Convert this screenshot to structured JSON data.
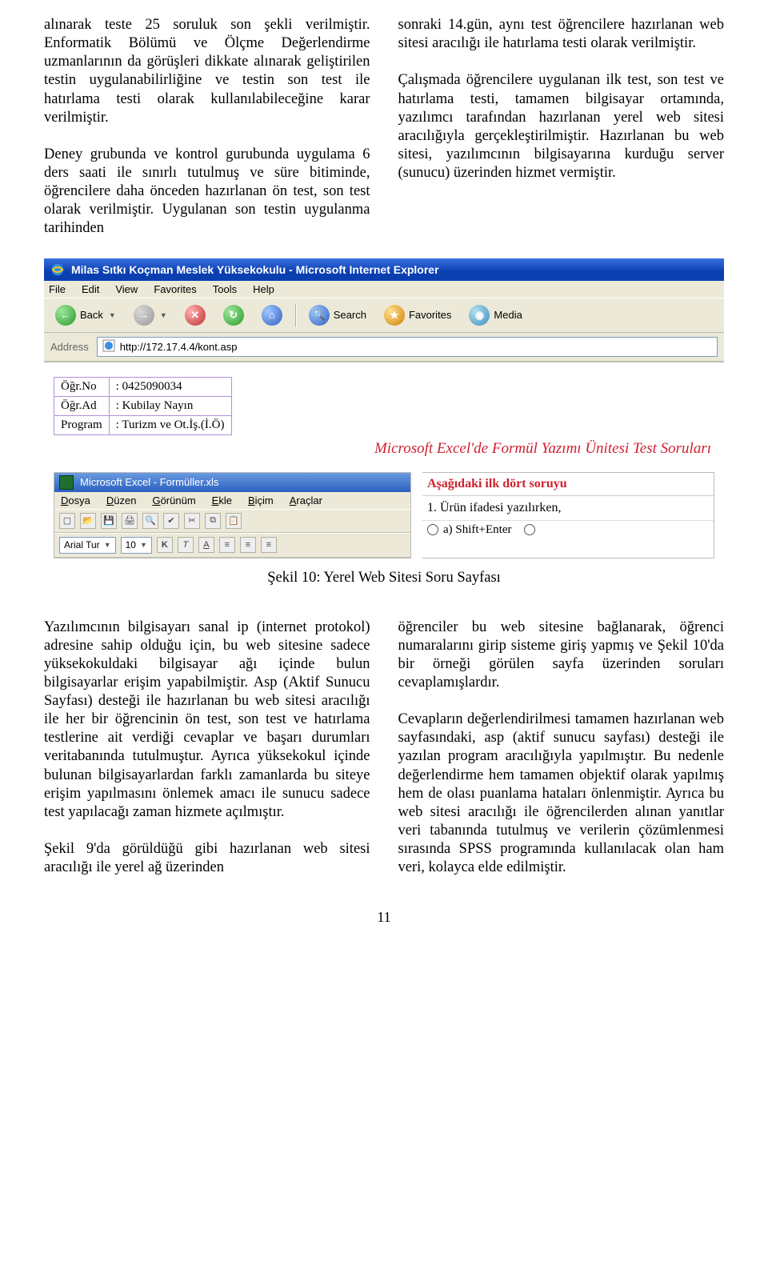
{
  "top": {
    "left_para": "alınarak teste 25 soruluk son şekli verilmiştir. Enformatik Bölümü ve Ölçme Değerlendirme uzmanlarının da görüşleri dikkate alınarak geliştirilen testin uygulanabilirliğine ve testin son test ile hatırlama testi olarak kullanılabileceğine karar verilmiştir.",
    "left_para2": "Deney grubunda ve kontrol gurubunda uygulama 6 ders saati ile sınırlı tutulmuş ve süre bitiminde, öğrencilere daha önceden hazırlanan ön test, son test olarak verilmiştir. Uygulanan son testin uygulanma tarihinden",
    "right_para1": "sonraki 14.gün, aynı test öğrencilere hazırlanan web sitesi aracılığı ile hatırlama testi olarak verilmiştir.",
    "right_para2": "Çalışmada öğrencilere uygulanan ilk test, son test ve hatırlama testi, tamamen bilgisayar ortamında, yazılımcı tarafından hazırlanan yerel web sitesi aracılığıyla gerçekleştirilmiştir. Hazırlanan bu web sitesi, yazılımcının bilgisayarına kurduğu server (sunucu) üzerinden hizmet vermiştir."
  },
  "browser": {
    "title": "Milas Sıtkı Koçman Meslek Yüksekokulu - Microsoft Internet Explorer",
    "menu": {
      "file": "File",
      "edit": "Edit",
      "view": "View",
      "favorites": "Favorites",
      "tools": "Tools",
      "help": "Help"
    },
    "back": "Back",
    "search": "Search",
    "favorites_btn": "Favorites",
    "media": "Media",
    "address_label": "Address",
    "url": "http://172.17.4.4/kont.asp"
  },
  "info": {
    "no_label": "Öğr.No",
    "no_val": ": 0425090034",
    "ad_label": "Öğr.Ad",
    "ad_val": ": Kubilay Nayın",
    "prog_label": "Program",
    "prog_val": ": Turizm ve Ot.İş.(İ.Ö)"
  },
  "test_title": "Microsoft Excel'de Formül Yazımı Ünitesi Test Soruları",
  "excel": {
    "title": "Microsoft Excel - Formüller.xls",
    "menu": {
      "dosya": "Dosya",
      "duzen": "Düzen",
      "gorunum": "Görünüm",
      "ekle": "Ekle",
      "bicim": "Biçim",
      "araclar": "Araçlar"
    },
    "font": "Arial Tur",
    "size": "10"
  },
  "question": {
    "heading": "Aşağıdaki ilk dört soruyu",
    "q1": "1. Ürün ifadesi yazılırken,",
    "opt_a": "a) Shift+Enter"
  },
  "caption": "Şekil 10: Yerel Web Sitesi Soru Sayfası",
  "bottom": {
    "left_p1": "Yazılımcının bilgisayarı sanal ip (internet protokol) adresine sahip olduğu için, bu web sitesine sadece yüksekokuldaki bilgisayar ağı içinde bulun bilgisayarlar erişim yapabilmiştir. Asp (Aktif Sunucu Sayfası) desteği ile hazırlanan bu web sitesi aracılığı ile her bir öğrencinin ön test, son test ve hatırlama testlerine ait verdiği cevaplar ve başarı durumları veritabanında tutulmuştur. Ayrıca yüksekokul içinde bulunan bilgisayarlardan farklı zamanlarda bu siteye erişim yapılmasını önlemek amacı ile sunucu sadece test yapılacağı zaman hizmete açılmıştır.",
    "left_p2": "Şekil 9'da görüldüğü gibi hazırlanan web sitesi aracılığı ile yerel ağ üzerinden",
    "right_p1": "öğrenciler bu web sitesine bağlanarak, öğrenci numaralarını girip sisteme giriş yapmış ve Şekil 10'da bir örneği görülen sayfa üzerinden soruları cevaplamışlardır.",
    "right_p2": "Cevapların değerlendirilmesi tamamen hazırlanan web sayfasındaki, asp (aktif sunucu sayfası) desteği ile yazılan program aracılığıyla yapılmıştır. Bu nedenle değerlendirme hem tamamen objektif olarak yapılmış hem de olası puanlama hataları önlenmiştir. Ayrıca bu web sitesi aracılığı ile öğrencilerden alınan yanıtlar veri tabanında tutulmuş ve verilerin çözümlenmesi sırasında SPSS programında kullanılacak olan ham veri, kolayca elde edilmiştir."
  },
  "pagenum": "11"
}
